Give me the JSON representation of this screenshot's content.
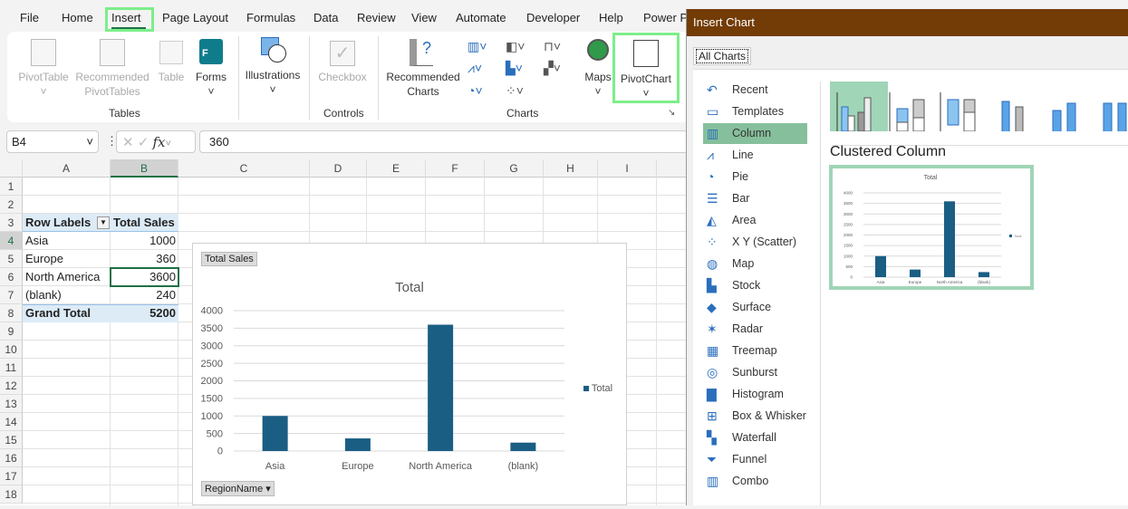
{
  "tabs": [
    "File",
    "Home",
    "Insert",
    "Page Layout",
    "Formulas",
    "Data",
    "Review",
    "View",
    "Automate",
    "Developer",
    "Help",
    "Power P"
  ],
  "active_tab": "Insert",
  "ribbon": {
    "pivottable": "PivotTable",
    "recommended_pivottables": "Recommended PivotTables",
    "table": "Table",
    "forms": "Forms",
    "illustrations": "Illustrations",
    "checkbox": "Checkbox",
    "recommended_charts": "Recommended Charts",
    "maps": "Maps",
    "pivotchart": "PivotChart",
    "groups": {
      "tables": "Tables",
      "controls": "Controls",
      "charts": "Charts"
    }
  },
  "formula_bar": {
    "name_box": "B4",
    "fx": "fx",
    "value": "360"
  },
  "columns": [
    "A",
    "B",
    "C",
    "D",
    "E",
    "F",
    "G",
    "H",
    "I"
  ],
  "rows": [
    "1",
    "2",
    "3",
    "4",
    "5",
    "6",
    "7",
    "8",
    "9",
    "10",
    "11",
    "12",
    "13",
    "14",
    "15",
    "16",
    "17",
    "18"
  ],
  "pivot": {
    "header_labels": "Row Labels",
    "header_sales": "Total Sales",
    "rows": [
      {
        "label": "Asia",
        "value": "1000"
      },
      {
        "label": "Europe",
        "value": "360"
      },
      {
        "label": "North America",
        "value": "3600"
      },
      {
        "label": "(blank)",
        "value": "240"
      }
    ],
    "grand_total_label": "Grand Total",
    "grand_total": "5200"
  },
  "chart_data": {
    "type": "bar",
    "title": "Total",
    "field_button": "Total Sales",
    "axis_field_button": "RegionName",
    "legend": "Total",
    "legend_position": "right",
    "categories": [
      "Asia",
      "Europe",
      "North America",
      "(blank)"
    ],
    "values": [
      1000,
      360,
      3600,
      240
    ],
    "yticks": [
      "0",
      "500",
      "1000",
      "1500",
      "2000",
      "2500",
      "3000",
      "3500",
      "4000"
    ],
    "ylim": [
      0,
      4000
    ],
    "bar_color": "#1a5e84"
  },
  "dialog": {
    "title": "Insert Chart",
    "tab": "All Charts",
    "selected_type": "Column",
    "subtype_title": "Clustered Column",
    "types": [
      "Recent",
      "Templates",
      "Column",
      "Line",
      "Pie",
      "Bar",
      "Area",
      "X Y (Scatter)",
      "Map",
      "Stock",
      "Surface",
      "Radar",
      "Treemap",
      "Sunburst",
      "Histogram",
      "Box & Whisker",
      "Waterfall",
      "Funnel",
      "Combo"
    ]
  }
}
